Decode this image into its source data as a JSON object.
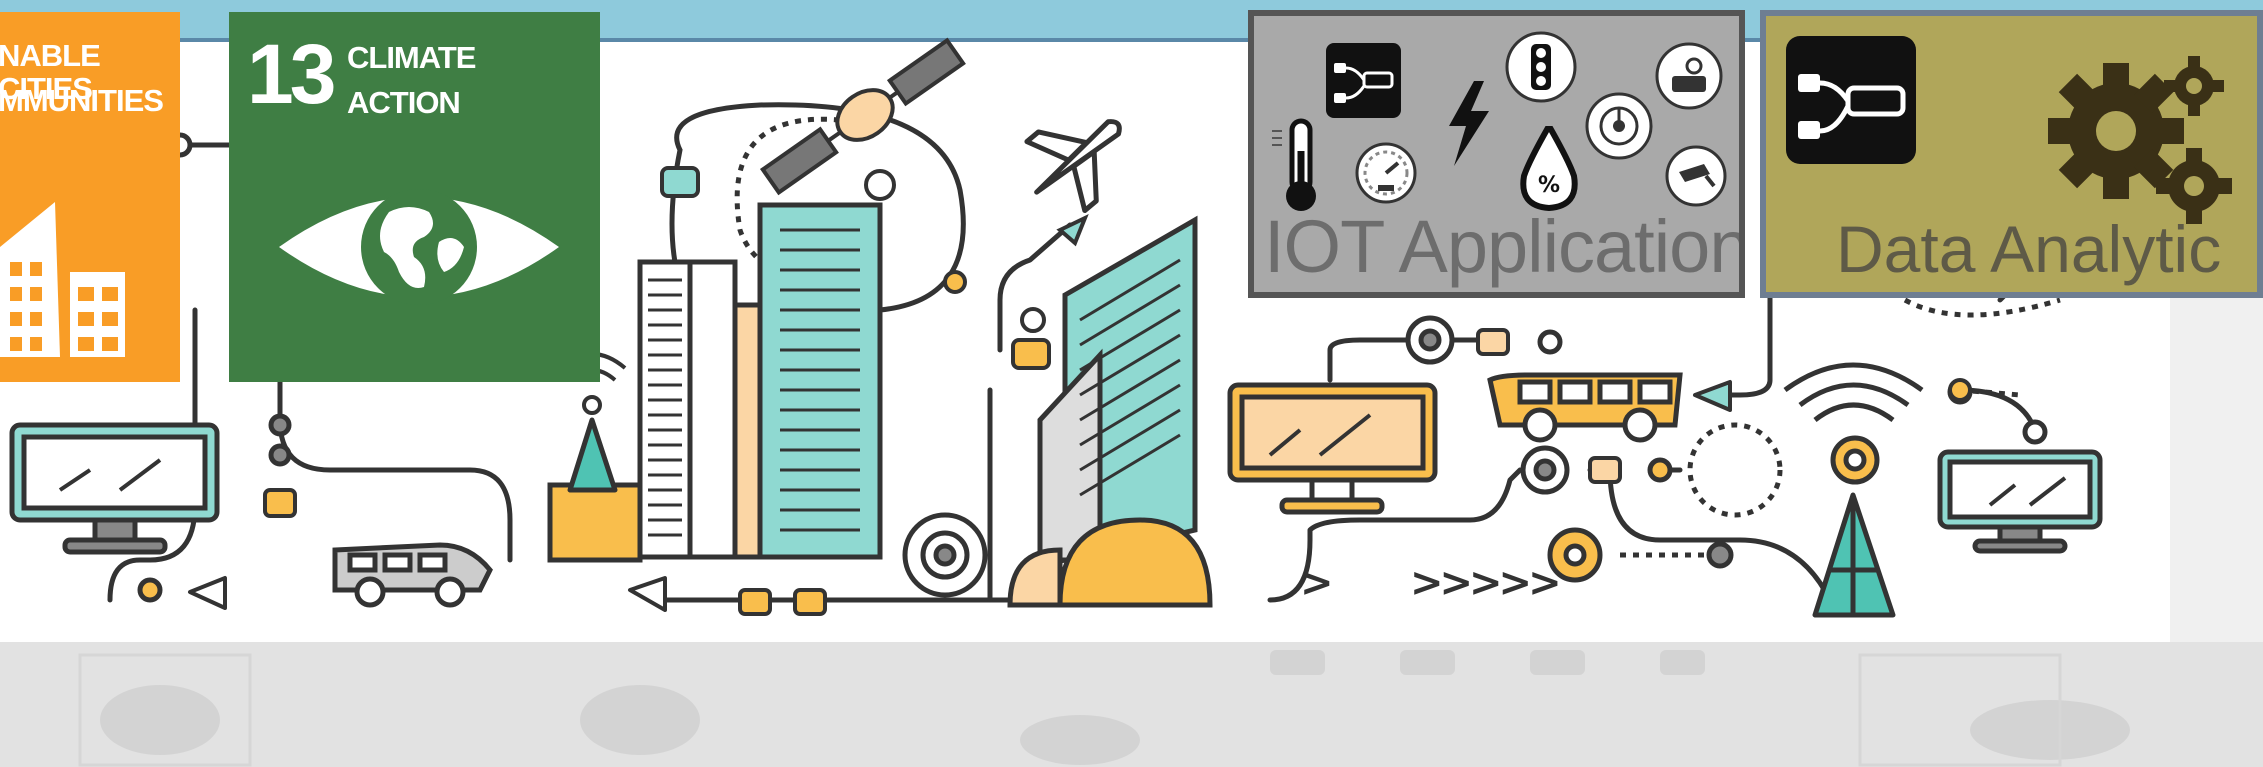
{
  "sdg11": {
    "line1": "NABLE CITIES",
    "line2": "MMUNITIES"
  },
  "sdg13": {
    "number": "13",
    "line1": "CLIMATE",
    "line2": "ACTION"
  },
  "iot_panel": {
    "label": "IOT Application",
    "icons": [
      "node-red-icon",
      "thermometer-icon",
      "gauge-icon",
      "lightning-icon",
      "traffic-light-icon",
      "water-drop-icon",
      "humidity-percent-icon",
      "dial-icon",
      "gas-sensor-icon",
      "cctv-icon"
    ]
  },
  "analytic_panel": {
    "label": "Data Analytic",
    "icons": [
      "node-red-icon",
      "gears-icon"
    ]
  },
  "illustration": {
    "chevrons_short": ">",
    "chevrons_long": ">>>>>"
  },
  "colors": {
    "sdg11": "#f99d26",
    "sdg13": "#3f7e44",
    "iot_bg": "#a9a9a9",
    "analytic_bg": "#b0a65a",
    "teal": "#8fd9d1",
    "yellow": "#f9be4c",
    "sky": "#8ecadc"
  }
}
